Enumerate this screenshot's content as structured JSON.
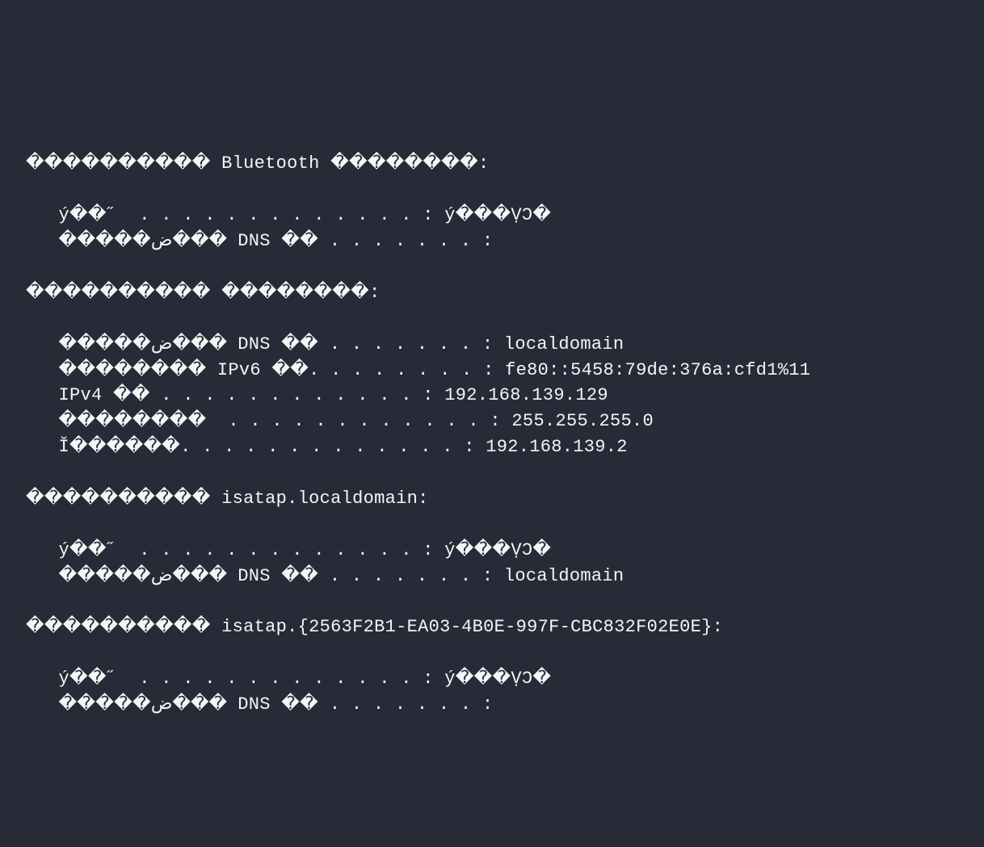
{
  "terminal": {
    "sections": {
      "bluetooth": {
        "header": "���������� Bluetooth ��������:",
        "line1": "   ý��˝  . . . . . . . . . . . . . : ý���ṾϽ�",
        "line2": "   �����ض��� DNS ��￻ . . . . . . . :"
      },
      "ethernet": {
        "header": "���������� ��������:",
        "line1": "   �����ض��� DNS ��￻ . . . . . . . : localdomain",
        "line2": "   �������� IPv6 ��. . . . . . . . : fe80::5458:79de:376a:cfd1%11",
        "line3": "   IPv4 �� . . . . . . . . . . . . : 192.168.139.129",
        "line4": "   ��������  . . . . . . . . . . . . : 255.255.255.0",
        "line5": "   Ĭ������. . . . . . . . . . . . . : 192.168.139.2"
      },
      "isatap1": {
        "header": "���������� isatap.localdomain:",
        "line1": "   ý��˝  . . . . . . . . . . . . . : ý���ṾϽ�",
        "line2": "   �����ض��� DNS ��￻ . . . . . . . : localdomain"
      },
      "isatap2": {
        "header": "���������� isatap.{2563F2B1-EA03-4B0E-997F-CBC832F02E0E}:",
        "line1": "   ý��˝  . . . . . . . . . . . . . : ý���ṾϽ�",
        "line2": "   �����ض��� DNS ��￻ . . . . . . . :"
      }
    }
  }
}
